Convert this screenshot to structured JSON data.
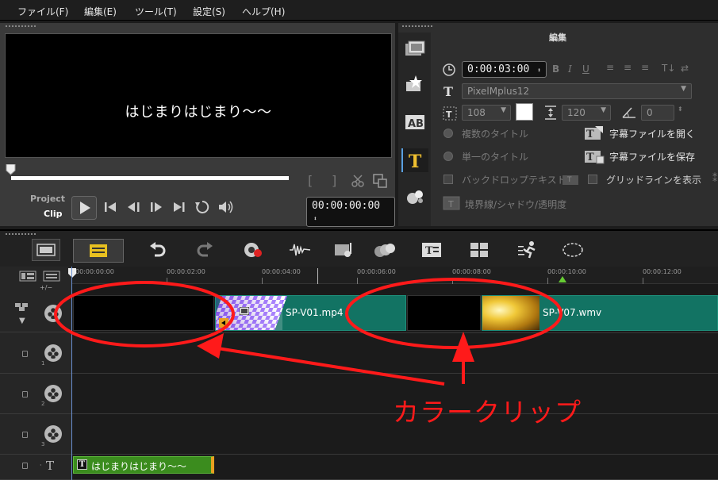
{
  "menubar": {
    "items": [
      "ファイル(F)",
      "編集(E)",
      "ツール(T)",
      "設定(S)",
      "ヘルプ(H)"
    ]
  },
  "preview": {
    "overlay_text": "はじまりはじまり〜〜",
    "mode_project": "Project",
    "mode_clip": "Clip",
    "timecode": "00:00:00:00"
  },
  "edit_panel": {
    "title": "編集",
    "duration": "0:00:03:00",
    "font": "PixelMplus12",
    "font_size": "108",
    "line_spacing": "120",
    "rotation": "0",
    "multi_title": "複数のタイトル",
    "single_title": "単一のタイトル",
    "backdrop_text": "バックドロップテキスト",
    "open_subtitle": "字幕ファイルを開く",
    "save_subtitle": "字幕ファイルを保存",
    "show_gridlines": "グリッドラインを表示",
    "border_shadow": "境界線/シャドウ/透明度",
    "text_color": "#ffffff",
    "sidebar_icons": [
      "media-icon",
      "transition-icon",
      "title-ab-icon",
      "title-t-icon",
      "effects-icon"
    ]
  },
  "timeline": {
    "ruler_labels": [
      "00:00:00:00",
      "00:00:02:00",
      "00:00:04:00",
      "00:00:06:00",
      "00:00:08:00",
      "00:00:10:00",
      "00:00:12:00"
    ],
    "track_numbers": [
      "1",
      "2",
      "3"
    ],
    "title_track_label": "T",
    "clips": {
      "video1_name": "SP-V01.mp4",
      "video2_name": "SP-V07.wmv",
      "title_clip": "はじまりはじまり〜〜"
    },
    "clip_color": "#127363",
    "title_clip_color": "#3b8c1e"
  },
  "annotation": {
    "text": "カラークリップ",
    "color": "#ff1a1a"
  }
}
